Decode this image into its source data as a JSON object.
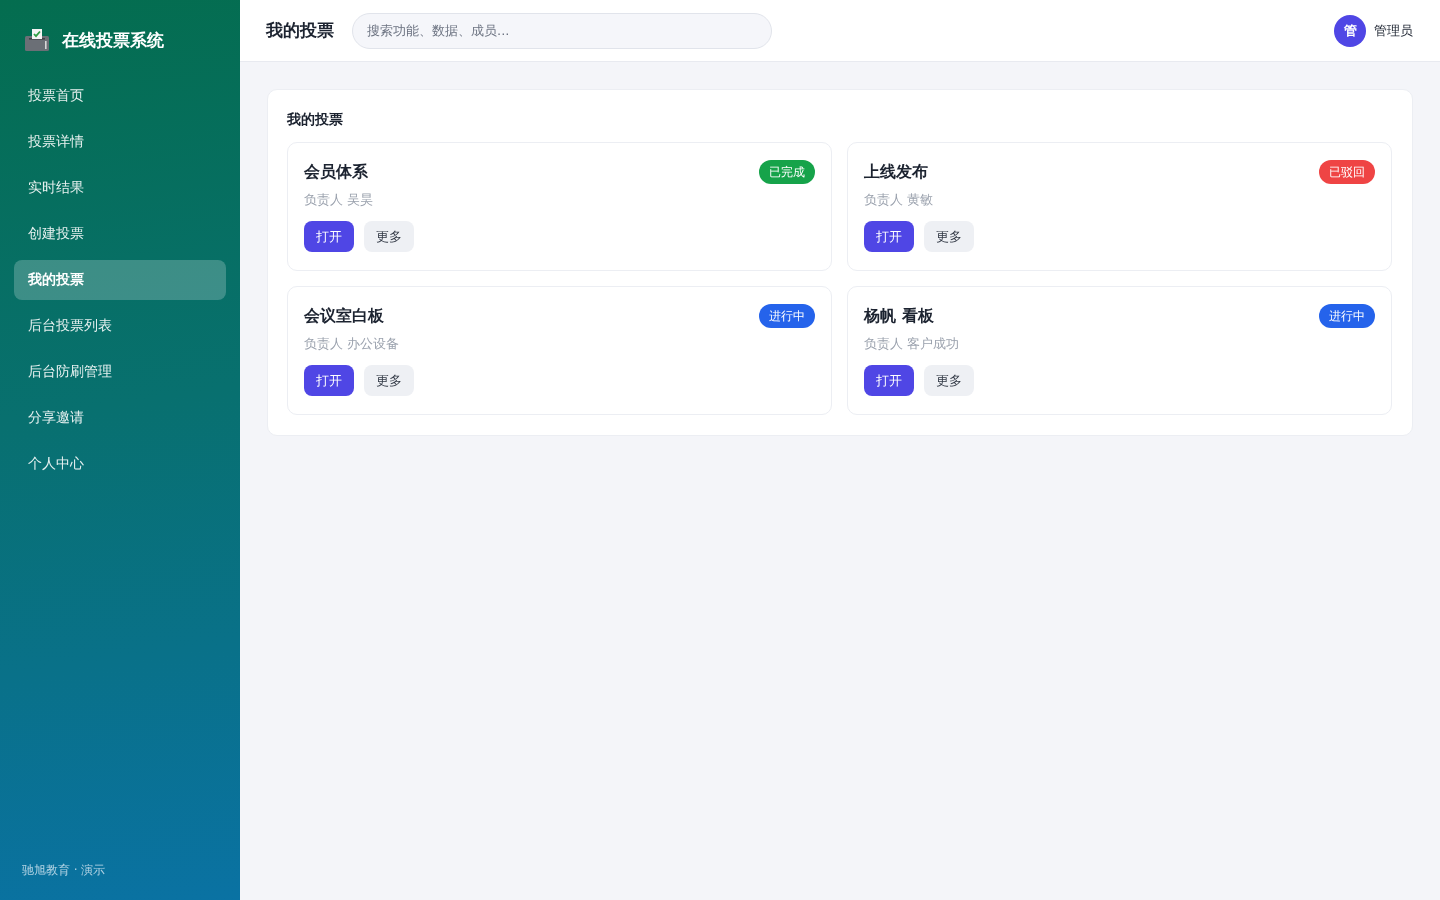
{
  "sidebar": {
    "brand": "在线投票系统",
    "items": [
      {
        "label": "投票首页",
        "selected": false
      },
      {
        "label": "投票详情",
        "selected": false
      },
      {
        "label": "实时结果",
        "selected": false
      },
      {
        "label": "创建投票",
        "selected": false
      },
      {
        "label": "我的投票",
        "selected": true
      },
      {
        "label": "后台投票列表",
        "selected": false
      },
      {
        "label": "后台防刷管理",
        "selected": false
      },
      {
        "label": "分享邀请",
        "selected": false
      },
      {
        "label": "个人中心",
        "selected": false
      }
    ],
    "footer": "驰旭教育 · 演示"
  },
  "header": {
    "title": "我的投票",
    "search": {
      "placeholder": "搜索功能、数据、成员..."
    },
    "user": {
      "avatar": "管",
      "name": "管理员"
    }
  },
  "panel": {
    "title": "我的投票",
    "cards": [
      {
        "title": "会员体系",
        "status": "已完成",
        "color": "#16a34a",
        "owner": "负责人 吴昊",
        "actions": [
          {
            "label": "打开",
            "kind": "primary"
          },
          {
            "label": "更多",
            "kind": "secondary"
          }
        ]
      },
      {
        "title": "上线发布",
        "status": "已驳回",
        "color": "#ef4444",
        "owner": "负责人 黄敏",
        "actions": [
          {
            "label": "打开",
            "kind": "primary"
          },
          {
            "label": "更多",
            "kind": "secondary"
          }
        ]
      },
      {
        "title": "会议室白板",
        "status": "进行中",
        "color": "#2563eb",
        "owner": "负责人 办公设备",
        "actions": [
          {
            "label": "打开",
            "kind": "primary"
          },
          {
            "label": "更多",
            "kind": "secondary"
          }
        ]
      },
      {
        "title": "杨帆 看板",
        "status": "进行中",
        "color": "#2563eb",
        "owner": "负责人 客户成功",
        "actions": [
          {
            "label": "打开",
            "kind": "primary"
          },
          {
            "label": "更多",
            "kind": "secondary"
          }
        ]
      }
    ]
  }
}
